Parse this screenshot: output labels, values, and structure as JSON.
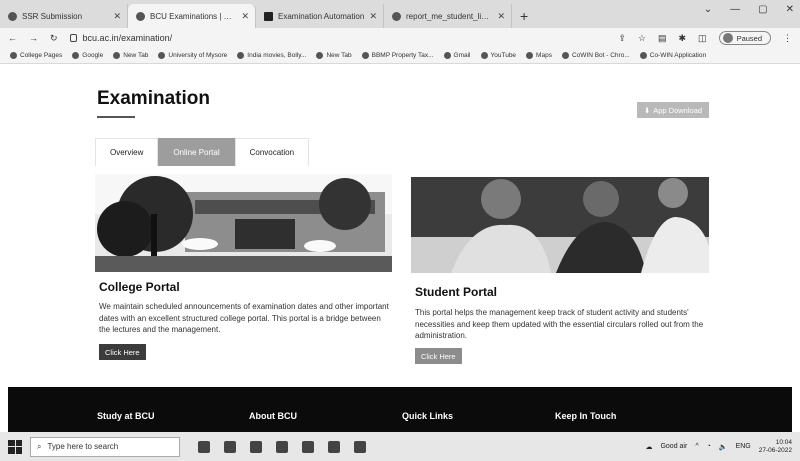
{
  "browser": {
    "tabs": [
      {
        "title": "SSR Submission",
        "active": false,
        "icon": "globe-icon"
      },
      {
        "title": "BCU Examinations | Bengaluru C",
        "active": true,
        "icon": "bcu-favicon"
      },
      {
        "title": "Examination Automation",
        "active": false,
        "icon": "document-icon"
      },
      {
        "title": "report_me_student_list.pdf",
        "active": false,
        "icon": "globe-icon"
      }
    ],
    "new_tab": "+",
    "url": "bcu.ac.in/examination/",
    "profile": "Paused",
    "bookmarks": [
      "College Pages",
      "Google",
      "New Tab",
      "University of Mysore",
      "India movies, Bolly...",
      "New Tab",
      "BBMP Property Tax...",
      "Gmail",
      "YouTube",
      "Maps",
      "CoWIN Bot - Chro...",
      "Co-WIN Application"
    ]
  },
  "page": {
    "title": "Examination",
    "app_download": "App Download",
    "tabs": [
      "Overview",
      "Online Portal",
      "Convocation"
    ],
    "active_tab": "Online Portal",
    "college_portal": {
      "heading": "College Portal",
      "text": "We maintain scheduled announcements of examination dates and other important dates with an excellent structured college portal. This portal is a bridge between the lectures and the management.",
      "button": "Click Here"
    },
    "student_portal": {
      "heading": "Student Portal",
      "text": "This portal helps the management keep track of student activity and students' necessities and keep them updated with the essential circulars rolled out from the administration.",
      "button": "Click Here"
    },
    "footer": [
      "Study at BCU",
      "About BCU",
      "Quick Links",
      "Keep In Touch"
    ]
  },
  "taskbar": {
    "search_placeholder": "Type here to search",
    "weather": "Good air",
    "lang": "ENG",
    "time": "10:04",
    "date": "27-06-2022"
  }
}
